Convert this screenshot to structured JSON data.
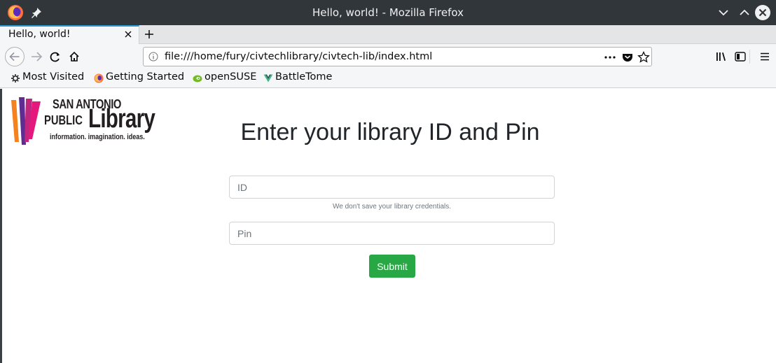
{
  "window": {
    "title": "Hello, world! - Mozilla Firefox"
  },
  "tabs": [
    {
      "label": "Hello, world!"
    }
  ],
  "navbar": {
    "url": "file:///home/fury/civtechlibrary/civtech-lib/index.html",
    "more_label": "•••"
  },
  "bookmarks": [
    {
      "label": "Most Visited",
      "icon": "gear-icon"
    },
    {
      "label": "Getting Started",
      "icon": "firefox-icon"
    },
    {
      "label": "openSUSE",
      "icon": "opensuse-icon"
    },
    {
      "label": "BattleTome",
      "icon": "vue-icon"
    }
  ],
  "page": {
    "logo": {
      "line1": "SAN ANTONIO",
      "line2": "PUBLIC",
      "line3": "Library",
      "tagline": "information. imagination. ideas."
    },
    "heading": "Enter your library ID and Pin",
    "id_field": {
      "placeholder": "ID",
      "value": ""
    },
    "help_text": "We don't save your library credentials.",
    "pin_field": {
      "placeholder": "Pin",
      "value": ""
    },
    "submit_label": "Submit"
  },
  "colors": {
    "titlebar": "#31363b",
    "accent_tab": "#2d9ad6",
    "submit": "#28a745"
  }
}
